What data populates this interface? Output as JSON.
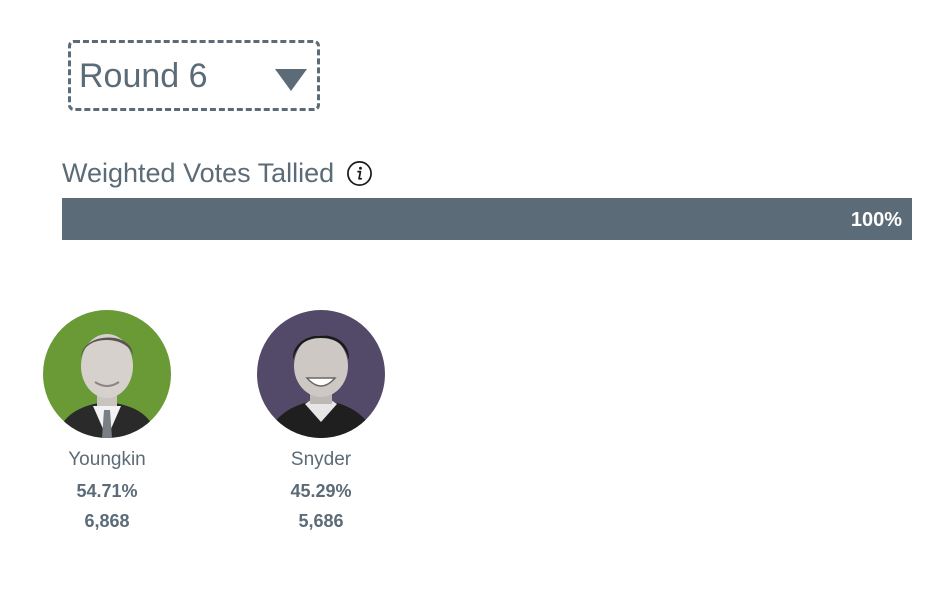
{
  "round_selector": {
    "label": "Round 6"
  },
  "tally": {
    "heading": "Weighted Votes Tallied",
    "progress_percent": 100,
    "progress_label": "100%"
  },
  "candidates": [
    {
      "name": "Youngkin",
      "percent": "54.71%",
      "votes": "6,868",
      "avatar_bg": "#6a9a36"
    },
    {
      "name": "Snyder",
      "percent": "45.29%",
      "votes": "5,686",
      "avatar_bg": "#534a69"
    }
  ],
  "colors": {
    "text": "#5b6b77",
    "bar": "#5b6b77"
  }
}
